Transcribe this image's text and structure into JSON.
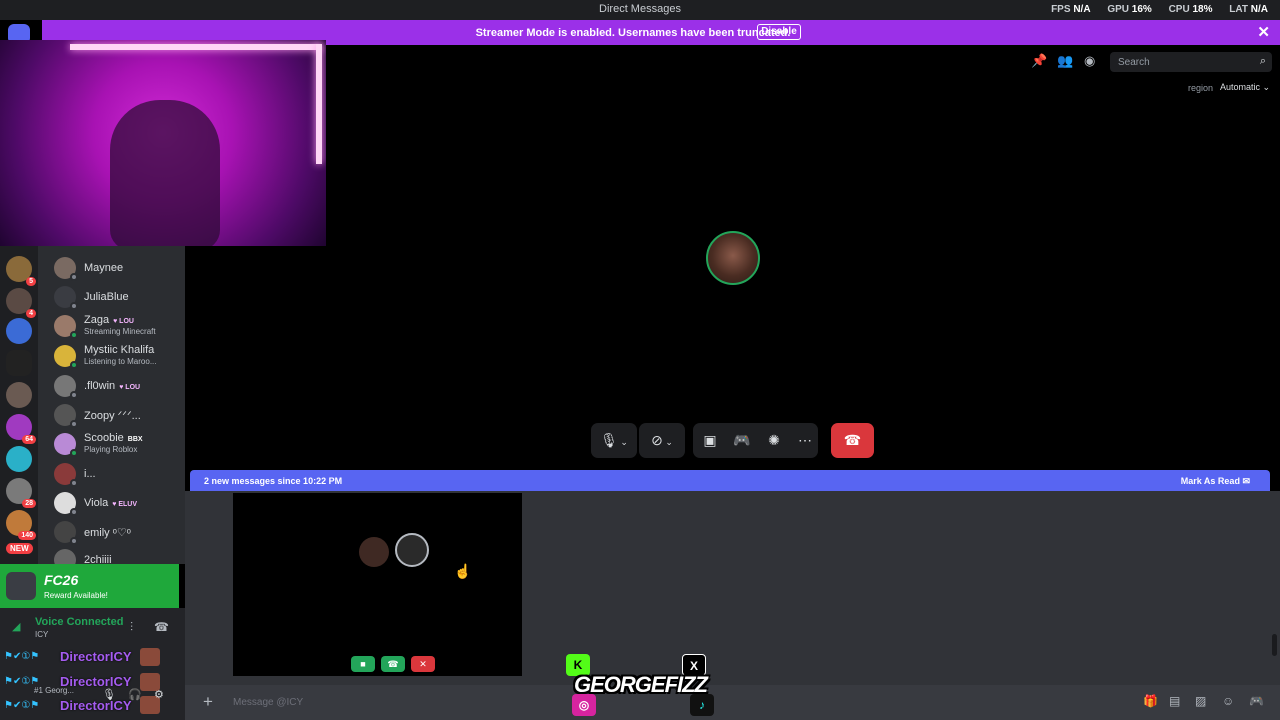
{
  "titlebar": {
    "title": "Direct Messages",
    "stats": [
      {
        "label": "FPS",
        "value": "N/A"
      },
      {
        "label": "GPU",
        "value": "16%"
      },
      {
        "label": "CPU",
        "value": "18%"
      },
      {
        "label": "LAT",
        "value": "N/A"
      }
    ]
  },
  "banner": {
    "message": "Streamer Mode is enabled. Usernames have been truncated.",
    "disable_label": "Disable"
  },
  "server_badges": [
    "5",
    "4",
    "64",
    "28",
    "140"
  ],
  "new_label": "NEW",
  "dms": [
    {
      "name": "Maynee",
      "tag": "",
      "activity": ""
    },
    {
      "name": "JuliaBlue",
      "tag": "",
      "activity": ""
    },
    {
      "name": "Zaga",
      "tag": "♥ LOU",
      "activity": "Streaming Minecraft"
    },
    {
      "name": "Mystiic Khalifa",
      "tag": "",
      "activity": "Listening to Maroo..."
    },
    {
      "name": ".fl0win",
      "tag": "♥ LOU",
      "activity": ""
    },
    {
      "name": "Zoopy ᐟᐟᐟ...",
      "tag": "",
      "activity": ""
    },
    {
      "name": "Scoobie",
      "tag": "BBX",
      "activity": "Playing Roblox"
    },
    {
      "name": "i...",
      "tag": "",
      "activity": ""
    },
    {
      "name": "Viola",
      "tag": "♥ ELUV",
      "activity": ""
    },
    {
      "name": "emily ᵒ♡ᵒ",
      "tag": "",
      "activity": ""
    },
    {
      "name": "2chiiii",
      "tag": "",
      "activity": ""
    }
  ],
  "promo": {
    "title": "FC26",
    "subtitle": "Reward Available!"
  },
  "voice": {
    "status": "Voice Connected",
    "channel": "ICY"
  },
  "user_panel": {
    "names": [
      "DirectorICY",
      "DirectorICY",
      "DirectorICY"
    ],
    "handle": "#1 Georg..."
  },
  "call": {
    "search_placeholder": "Search",
    "region_label": "region",
    "region_value": "Automatic"
  },
  "new_messages": {
    "text": "2 new messages since 10:22 PM",
    "mark_read": "Mark As Read"
  },
  "composer": {
    "placeholder": "Message @ICY"
  },
  "overlay": {
    "name": "GEORGEFIZZ"
  },
  "colors": {
    "accent": "#5865f2",
    "streamer": "#9b30e8",
    "online": "#23a55a",
    "danger": "#da373c",
    "promo": "#1fa83b"
  }
}
